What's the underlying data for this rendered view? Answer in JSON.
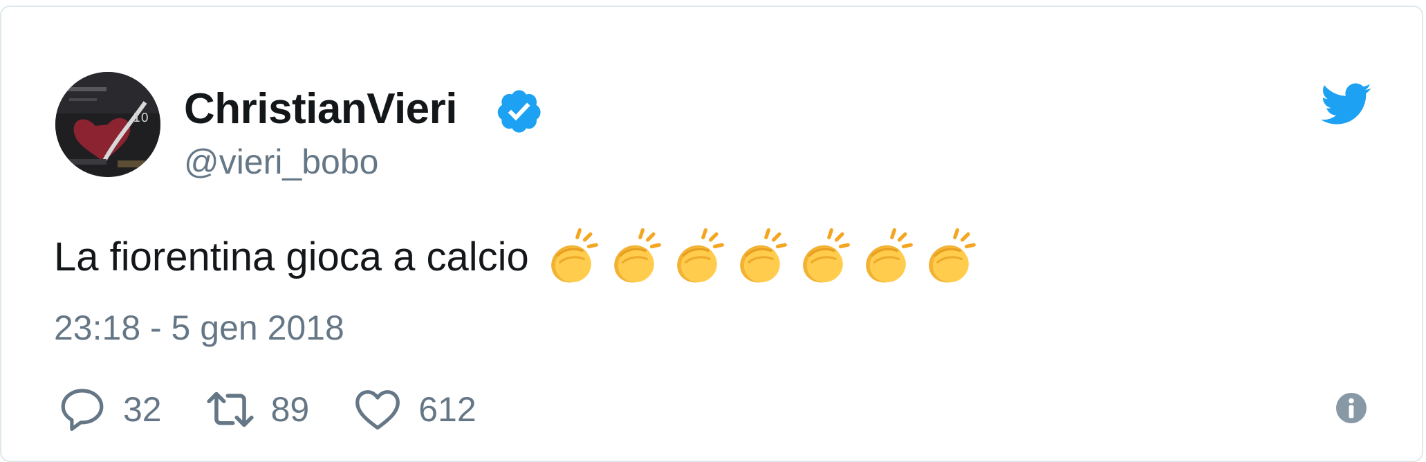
{
  "tweet": {
    "author": {
      "display_name": "ChristianVieri",
      "handle": "@vieri_bobo",
      "verified": true,
      "avatar_icon": "avatar-heart-image"
    },
    "text": "La fiorentina gioca a calcio",
    "emoji": {
      "name": "clapping-hands-emoji",
      "count": 7
    },
    "timestamp": "23:18 - 5 gen 2018",
    "actions": {
      "replies": "32",
      "retweets": "89",
      "likes": "612"
    }
  },
  "icons": {
    "brand": "twitter-bird-icon",
    "verified": "verified-badge-icon",
    "reply": "reply-icon",
    "retweet": "retweet-icon",
    "like": "heart-icon",
    "info": "info-icon"
  },
  "colors": {
    "brand_blue": "#1da1f2",
    "text_primary": "#14171a",
    "text_secondary": "#657786",
    "border": "#e1e8ed",
    "emoji_yellow": "#ffcc4d"
  }
}
